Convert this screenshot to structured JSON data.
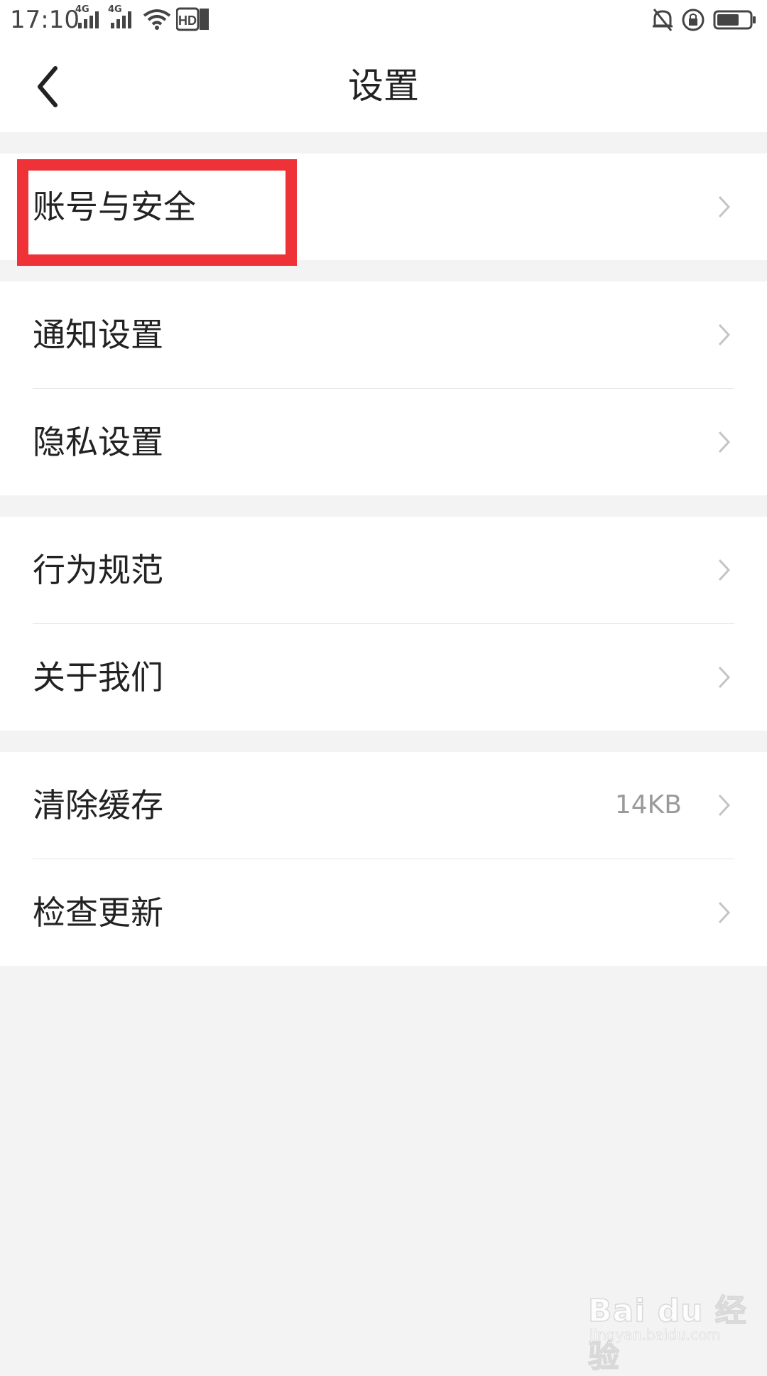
{
  "status_bar": {
    "time": "17:10",
    "network1": "4G",
    "network2": "4G",
    "hd_label": "HD",
    "icons": [
      "signal-icon",
      "signal-icon",
      "wifi-icon",
      "hd-icon",
      "mute-bell-icon",
      "rotation-lock-icon",
      "battery-icon"
    ]
  },
  "header": {
    "title": "设置",
    "back_icon": "chevron-left-icon"
  },
  "groups": [
    {
      "items": [
        {
          "label": "账号与安全"
        }
      ]
    },
    {
      "items": [
        {
          "label": "通知设置"
        },
        {
          "label": "隐私设置"
        }
      ]
    },
    {
      "items": [
        {
          "label": "行为规范"
        },
        {
          "label": "关于我们"
        }
      ]
    },
    {
      "items": [
        {
          "label": "清除缓存",
          "value": "14KB"
        },
        {
          "label": "检查更新"
        }
      ]
    }
  ],
  "watermark": {
    "brand": "Bai du 经验",
    "url": "jingyan.baidu.com"
  },
  "colors": {
    "highlight": "#ee3237",
    "background": "#f3f3f3",
    "card": "#ffffff",
    "value_text": "#9a9a9a",
    "chevron": "#c4c4c4"
  }
}
